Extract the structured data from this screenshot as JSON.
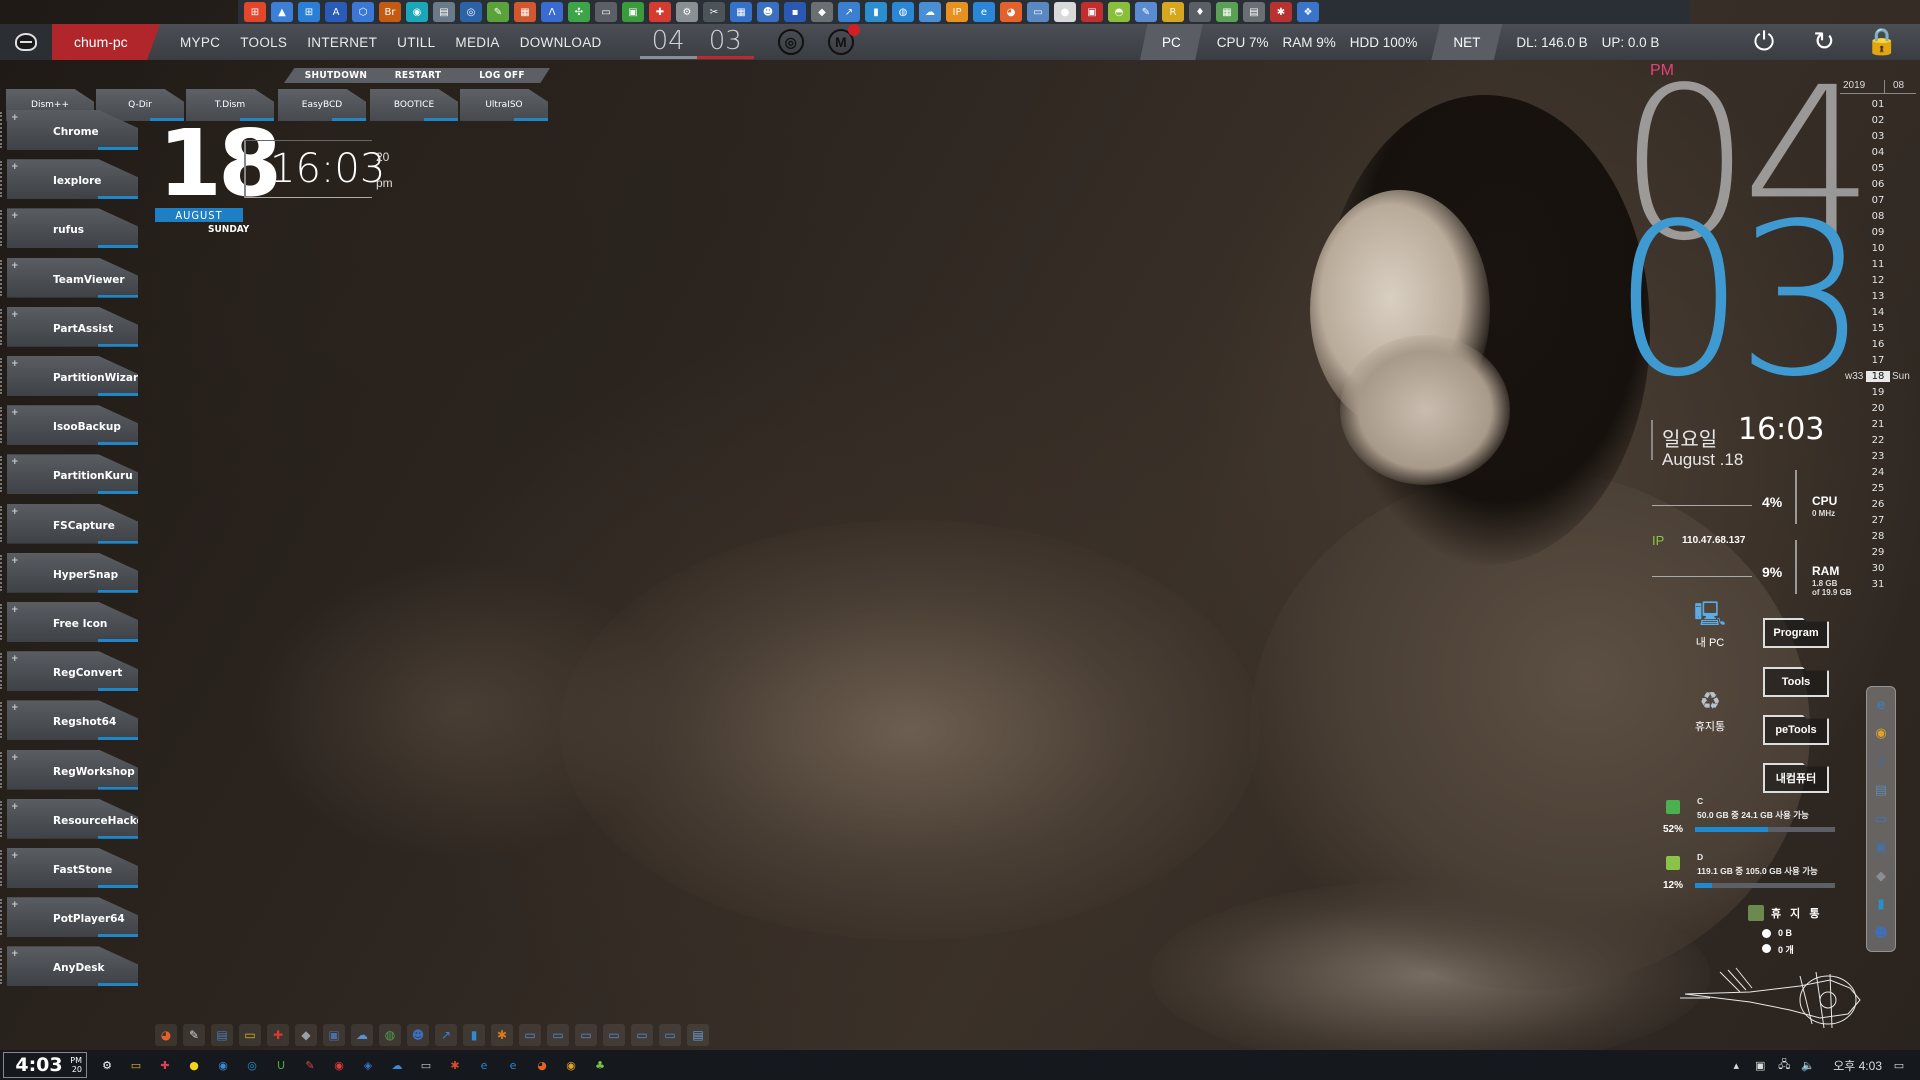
{
  "top_strip": {
    "icons": [
      {
        "name": "windows-logo-icon",
        "color": "#e4462b",
        "glyph": "⊞"
      },
      {
        "name": "drive-icon",
        "color": "#3d7fd6",
        "glyph": "▲"
      },
      {
        "name": "windows-icon",
        "color": "#2a7fd4",
        "glyph": "⊞"
      },
      {
        "name": "word-a-icon",
        "color": "#2b5bb8",
        "glyph": "A"
      },
      {
        "name": "network-icon",
        "color": "#3b78d6",
        "glyph": "⬡"
      },
      {
        "name": "bridge-icon",
        "color": "#c75a12",
        "glyph": "Br"
      },
      {
        "name": "disk-icon",
        "color": "#1ba7b8",
        "glyph": "◉"
      },
      {
        "name": "document-icon",
        "color": "#6a7a88",
        "glyph": "▤"
      },
      {
        "name": "camera-icon",
        "color": "#2b63a6",
        "glyph": "◎"
      },
      {
        "name": "pencil-icon",
        "color": "#5aa33b",
        "glyph": "✎"
      },
      {
        "name": "calendar-icon",
        "color": "#d1572f",
        "glyph": "▦"
      },
      {
        "name": "ruler-icon",
        "color": "#3a6bd1",
        "glyph": "Λ"
      },
      {
        "name": "puzzle-icon",
        "color": "#3da548",
        "glyph": "✣"
      },
      {
        "name": "printer-icon",
        "color": "#5c6066",
        "glyph": "▭"
      },
      {
        "name": "image-icon",
        "color": "#3a9b3c",
        "glyph": "▣"
      },
      {
        "name": "maps-icon",
        "color": "#d63b30",
        "glyph": "✚"
      },
      {
        "name": "tools-icon",
        "color": "#8a8f94",
        "glyph": "⚙"
      },
      {
        "name": "wrench-icon",
        "color": "#4c5359",
        "glyph": "✂"
      },
      {
        "name": "package-icon",
        "color": "#3671c9",
        "glyph": "▦"
      },
      {
        "name": "user-icon",
        "color": "#3b6fc2",
        "glyph": "☻"
      },
      {
        "name": "save-icon",
        "color": "#2a58b3",
        "glyph": "▪"
      },
      {
        "name": "diamond-icon",
        "color": "#6a6f74",
        "glyph": "◆"
      },
      {
        "name": "arrow-icon",
        "color": "#3b7fd1",
        "glyph": "↗"
      },
      {
        "name": "book-icon",
        "color": "#2c8ecf",
        "glyph": "▮"
      },
      {
        "name": "globe-icon",
        "color": "#2a87d6",
        "glyph": "◍"
      },
      {
        "name": "cloud-icon",
        "color": "#4a8fd6",
        "glyph": "☁"
      },
      {
        "name": "ip-icon",
        "color": "#e89120",
        "glyph": "IP"
      },
      {
        "name": "ie-icon",
        "color": "#2a86d6",
        "glyph": "e"
      },
      {
        "name": "firefox-icon",
        "color": "#e3612b",
        "glyph": "◕"
      },
      {
        "name": "folder-icon",
        "color": "#5a88c2",
        "glyph": "▭"
      },
      {
        "name": "media-icon",
        "color": "#d9d9d9",
        "glyph": "●"
      },
      {
        "name": "game-icon",
        "color": "#c02e2e",
        "glyph": "▣"
      },
      {
        "name": "android-icon",
        "color": "#89bf3a",
        "glyph": "◓"
      },
      {
        "name": "notes-icon",
        "color": "#5a8bd1",
        "glyph": "✎"
      },
      {
        "name": "r-icon",
        "color": "#d6a61e",
        "glyph": "R"
      },
      {
        "name": "drop-icon",
        "color": "#5a5f66",
        "glyph": "♦"
      },
      {
        "name": "box-icon",
        "color": "#5aa055",
        "glyph": "▦"
      },
      {
        "name": "keyboard-icon",
        "color": "#6a6f74",
        "glyph": "▤"
      },
      {
        "name": "spider-icon",
        "color": "#b83232",
        "glyph": "✱"
      },
      {
        "name": "network-share-icon",
        "color": "#3a75c9",
        "glyph": "❖"
      }
    ]
  },
  "top_bar": {
    "pc_name": "chum-pc",
    "nav": [
      "MYPC",
      "TOOLS",
      "INTERNET",
      "UTILL",
      "MEDIA",
      "DOWNLOAD"
    ],
    "hour": "04",
    "minute": "03",
    "pc_tab": "PC",
    "cpu": "CPU  7%",
    "ram": "RAM  9%",
    "hdd": "HDD  100%",
    "net_tab": "NET",
    "dl": "DL: 146.0 B",
    "up": "UP: 0.0 B"
  },
  "power_tabs": [
    "SHUTDOWN",
    "RESTART",
    "LOG OFF"
  ],
  "tool_tabs": [
    "Dism++",
    "Q-Dir",
    "T.Dism",
    "EasyBCD",
    "BOOTICE",
    "UltraISO"
  ],
  "launchers": [
    "Chrome",
    "Iexplore",
    "rufus",
    "TeamViewer",
    "PartAssist",
    "PartitionWizard",
    "IsooBackup",
    "PartitionKuru",
    "FSCapture",
    "HyperSnap",
    "Free  Icon",
    "RegConvert",
    "Regshot64",
    "RegWorkshop",
    "ResourceHacker",
    "FastStone",
    "PotPlayer64",
    "AnyDesk"
  ],
  "date_widget": {
    "day": "18",
    "month": "AUGUST",
    "weekday": "SUNDAY",
    "time": "16:03",
    "seconds": "20",
    "ampm": "pm"
  },
  "big_clock": {
    "period": "PM",
    "hour": "04",
    "minute": "03"
  },
  "calendar": {
    "year": "2019",
    "month": "08",
    "days": [
      "01",
      "02",
      "03",
      "04",
      "05",
      "06",
      "07",
      "08",
      "09",
      "10",
      "11",
      "12",
      "13",
      "14",
      "15",
      "16",
      "17",
      "18",
      "19",
      "20",
      "21",
      "22",
      "23",
      "24",
      "25",
      "26",
      "27",
      "28",
      "29",
      "30",
      "31"
    ],
    "today": "18",
    "week": "w33",
    "weekday_short": "Sun"
  },
  "info_panel": {
    "weekday_korean": "일요일",
    "time": "16:03",
    "date": "August .18",
    "cpu_pct": "4%",
    "cpu_label": "CPU",
    "cpu_sub": "0 MHz",
    "ip_label": "IP",
    "ip": "110.47.68.137",
    "ram_pct": "9%",
    "ram_label": "RAM",
    "ram_sub1": "1.8 GB",
    "ram_sub2": "of 19.9 GB"
  },
  "desktop_icons": {
    "my_pc": "내 PC",
    "recycle": "휴지통"
  },
  "folder_buttons": [
    "Program",
    "Tools",
    "peTools",
    "내컴퓨터"
  ],
  "drives": [
    {
      "letter": "C",
      "info": "50.0 GB 중   24.1 GB 사용 가능",
      "pct_label": "52%",
      "used_fraction": 0.52,
      "color": "#4caf50"
    },
    {
      "letter": "D",
      "info": "119.1 GB 중 105.0 GB 사용 가능",
      "pct_label": "12%",
      "used_fraction": 0.12,
      "color": "#8bc34a"
    }
  ],
  "recycle_bin": {
    "title": "휴 지 통",
    "size": "0 B",
    "count": "0 개"
  },
  "right_dock": [
    {
      "name": "ie-dock-icon",
      "glyph": "e",
      "color": "#2a86d6"
    },
    {
      "name": "chrome-dock-icon",
      "glyph": "◉",
      "color": "#e0a32a"
    },
    {
      "name": "slash-dock-icon",
      "glyph": "∕",
      "color": "#2b6fb8"
    },
    {
      "name": "doc-dock-icon",
      "glyph": "▤",
      "color": "#5f88b0"
    },
    {
      "name": "screen-dock-icon",
      "glyph": "▭",
      "color": "#3a78c9"
    },
    {
      "name": "printer-dock-icon",
      "glyph": "▣",
      "color": "#4a6fa3"
    },
    {
      "name": "diamond-dock-icon",
      "glyph": "◆",
      "color": "#8a8f94"
    },
    {
      "name": "book-dock-icon",
      "glyph": "▮",
      "color": "#2c8ecf"
    },
    {
      "name": "user-dock-icon",
      "glyph": "☻",
      "color": "#3b6fc2"
    }
  ],
  "quick_launch": [
    {
      "name": "firefox-quick-icon",
      "glyph": "◕",
      "color": "#e3612b"
    },
    {
      "name": "notes-quick-icon",
      "glyph": "✎",
      "color": "#cfd5db"
    },
    {
      "name": "doc-quick-icon",
      "glyph": "▤",
      "color": "#4a78b8"
    },
    {
      "name": "folder-quick-icon",
      "glyph": "▭",
      "color": "#d7b622"
    },
    {
      "name": "maps-quick-icon",
      "glyph": "✚",
      "color": "#d63b30"
    },
    {
      "name": "diamond-quick-icon",
      "glyph": "◆",
      "color": "#9aa0a6"
    },
    {
      "name": "pc-quick-icon",
      "glyph": "▣",
      "color": "#4a6fa3"
    },
    {
      "name": "cloud-quick-icon",
      "glyph": "☁",
      "color": "#5a90d4"
    },
    {
      "name": "globe-quick-icon",
      "glyph": "◍",
      "color": "#4fa04a"
    },
    {
      "name": "user-quick-icon",
      "glyph": "☻",
      "color": "#3b6fc2"
    },
    {
      "name": "arrow-quick-icon",
      "glyph": "↗",
      "color": "#3b7fd1"
    },
    {
      "name": "book-quick-icon",
      "glyph": "▮",
      "color": "#2c8ecf"
    },
    {
      "name": "tools-quick-icon",
      "glyph": "✱",
      "color": "#d97a1f"
    },
    {
      "name": "folder-a-quick-icon",
      "glyph": "▭",
      "color": "#5a8ccc"
    },
    {
      "name": "folder-b-quick-icon",
      "glyph": "▭",
      "color": "#5a8ccc"
    },
    {
      "name": "folder-c-quick-icon",
      "glyph": "▭",
      "color": "#5a8ccc"
    },
    {
      "name": "folder-d-quick-icon",
      "glyph": "▭",
      "color": "#5a8ccc"
    },
    {
      "name": "folder-e-quick-icon",
      "glyph": "▭",
      "color": "#5a8ccc"
    },
    {
      "name": "folder-f-quick-icon",
      "glyph": "▭",
      "color": "#5a8ccc"
    },
    {
      "name": "window-quick-icon",
      "glyph": "▤",
      "color": "#6a9fd8"
    }
  ],
  "taskbar": {
    "clock": "4:03",
    "clock_ampm": "PM",
    "clock_sec": "20",
    "icons": [
      {
        "name": "settings-taskbar-icon",
        "glyph": "⚙",
        "color": "#ffffff"
      },
      {
        "name": "explorer-taskbar-icon",
        "glyph": "▭",
        "color": "#e7b622"
      },
      {
        "name": "paint-taskbar-icon",
        "glyph": "✚",
        "color": "#e33c57"
      },
      {
        "name": "kakao-taskbar-icon",
        "glyph": "●",
        "color": "#f5d31c"
      },
      {
        "name": "chrome-taskbar-icon",
        "glyph": "◉",
        "color": "#3b8ad9"
      },
      {
        "name": "sync-taskbar-icon",
        "glyph": "◎",
        "color": "#1e9ad6"
      },
      {
        "name": "u-taskbar-icon",
        "glyph": "U",
        "color": "#43b049"
      },
      {
        "name": "edit-taskbar-icon",
        "glyph": "✎",
        "color": "#d44a4a"
      },
      {
        "name": "record-taskbar-icon",
        "glyph": "◉",
        "color": "#e23b3b"
      },
      {
        "name": "shield-taskbar-icon",
        "glyph": "◈",
        "color": "#3a73c9"
      },
      {
        "name": "cloud-taskbar-icon",
        "glyph": "☁",
        "color": "#3b8ad9"
      },
      {
        "name": "monitor-taskbar-icon",
        "glyph": "▭",
        "color": "#cccccc"
      },
      {
        "name": "tool-taskbar-icon",
        "glyph": "✱",
        "color": "#d94a2a"
      },
      {
        "name": "ie-taskbar-icon",
        "glyph": "e",
        "color": "#2a86d6"
      },
      {
        "name": "edge-taskbar-icon",
        "glyph": "e",
        "color": "#2a86d6"
      },
      {
        "name": "firefox-taskbar-icon",
        "glyph": "◕",
        "color": "#e3612b"
      },
      {
        "name": "chrome2-taskbar-icon",
        "glyph": "◉",
        "color": "#e0a32a"
      },
      {
        "name": "clover-taskbar-icon",
        "glyph": "♣",
        "color": "#7cc046"
      }
    ],
    "tray_time": "오후 4:03"
  }
}
